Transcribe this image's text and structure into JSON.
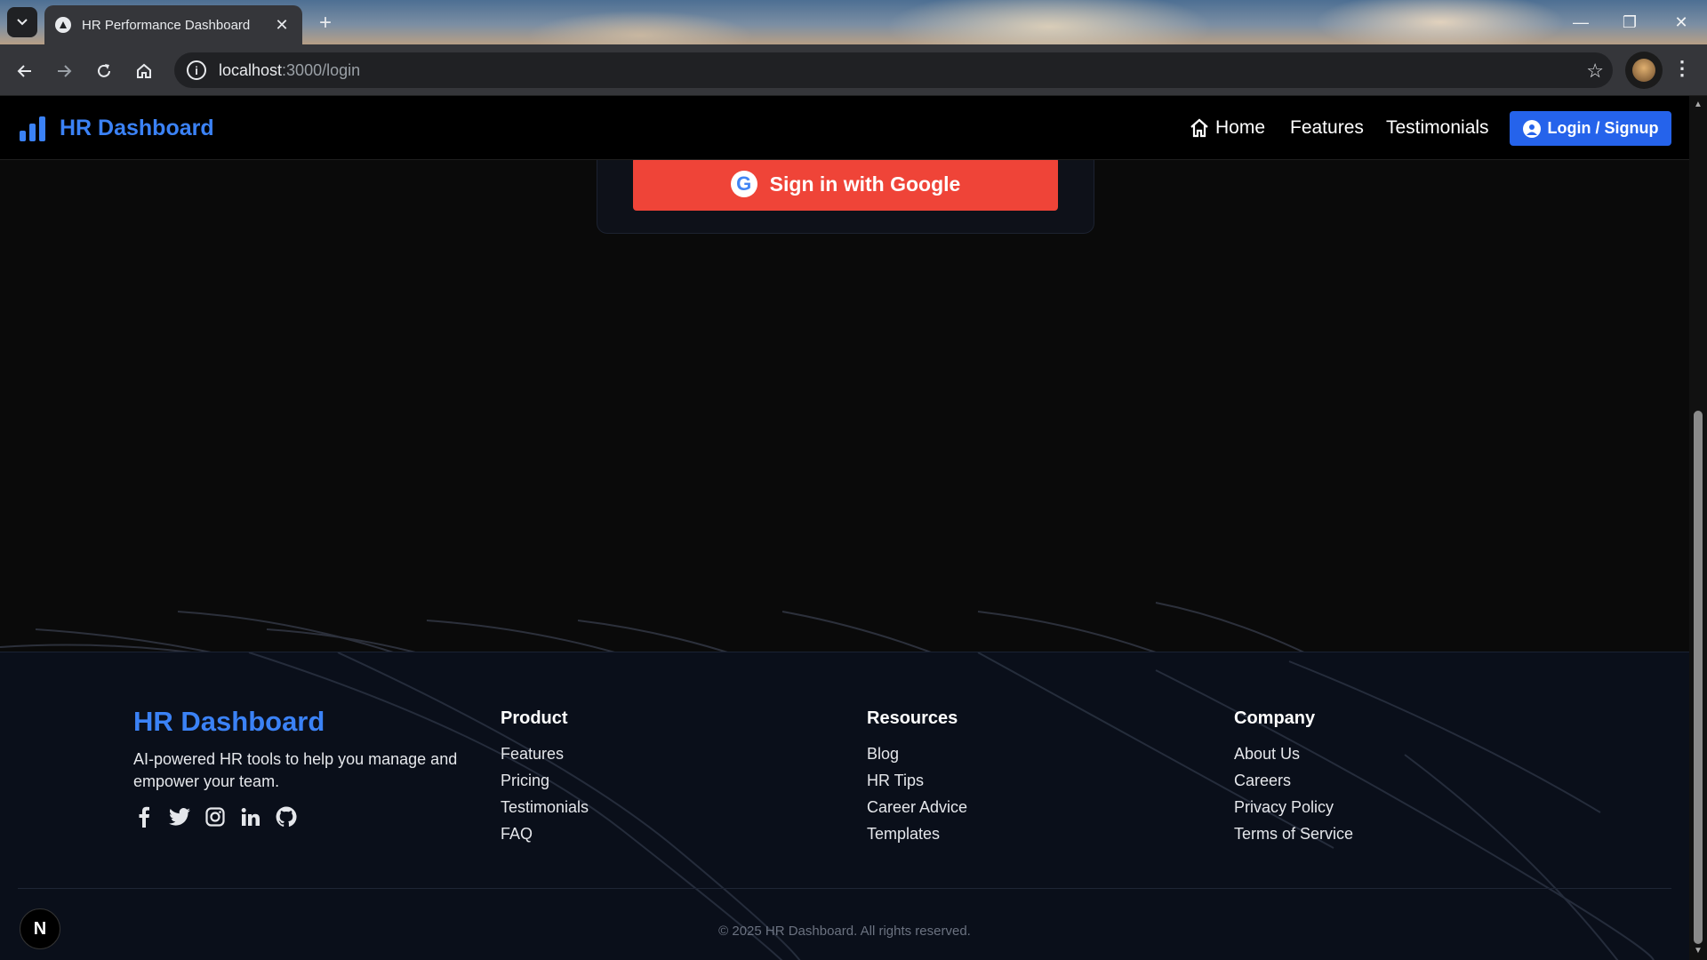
{
  "browser": {
    "tab_title": "HR Performance Dashboard",
    "url_host": "localhost",
    "url_rest": ":3000/login"
  },
  "navbar": {
    "brand": "HR Dashboard",
    "links": [
      "Home",
      "Features",
      "Testimonials"
    ],
    "login_label": "Login / Signup",
    "accent": "#3b82f6"
  },
  "login": {
    "google_button": "Sign in with Google",
    "google_color": "#ef4438"
  },
  "footer": {
    "brand": "HR Dashboard",
    "description": "AI-powered HR tools to help you manage and empower your team.",
    "socials": [
      "facebook-icon",
      "twitter-icon",
      "instagram-icon",
      "linkedin-icon",
      "github-icon"
    ],
    "columns": [
      {
        "title": "Product",
        "links": [
          "Features",
          "Pricing",
          "Testimonials",
          "FAQ"
        ]
      },
      {
        "title": "Resources",
        "links": [
          "Blog",
          "HR Tips",
          "Career Advice",
          "Templates"
        ]
      },
      {
        "title": "Company",
        "links": [
          "About Us",
          "Careers",
          "Privacy Policy",
          "Terms of Service"
        ]
      }
    ],
    "copyright": "© 2025 HR Dashboard. All rights reserved."
  },
  "dev_badge": "N"
}
